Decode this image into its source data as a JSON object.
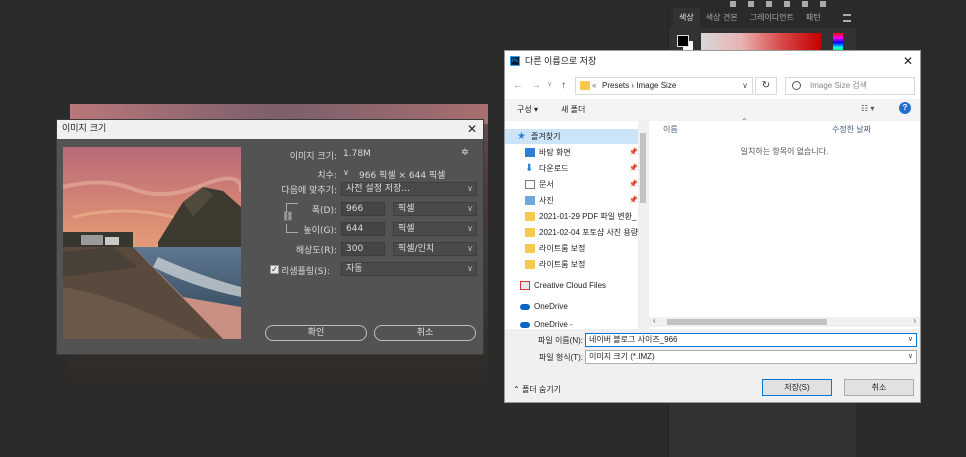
{
  "ps_panel": {
    "tabs": [
      "색상",
      "색상 견본",
      "그레이디언트",
      "패턴"
    ],
    "active_tab": "색상"
  },
  "image_size_dialog": {
    "title": "이미지 크기",
    "image_size_label": "이미지 크기:",
    "image_size_value": "1.78M",
    "dimensions_label": "치수:",
    "dimensions_value": "966 픽셀 × 644 픽셀",
    "fit_to_label": "다음에 맞추기:",
    "fit_to_value": "사전 설정 저장...",
    "width_label": "폭(D):",
    "width_value": "966",
    "width_unit": "픽셀",
    "height_label": "높이(G):",
    "height_value": "644",
    "height_unit": "픽셀",
    "resolution_label": "해상도(R):",
    "resolution_value": "300",
    "resolution_unit": "픽셀/인치",
    "resample_label": "리샘플링(S):",
    "resample_value": "자동",
    "resample_checked": true,
    "ok_label": "확인",
    "cancel_label": "취소"
  },
  "save_dialog": {
    "title": "다른 이름으로 저장",
    "app_icon": "Ps",
    "path_chevron": "«",
    "path": [
      "Presets",
      "Image Size"
    ],
    "search_placeholder": "Image Size 검색",
    "organize_label": "구성 ▾",
    "new_folder_label": "새 폴더",
    "nav_items": [
      {
        "label": "즐겨찾기",
        "icon": "star-icon"
      },
      {
        "label": "바탕 화면",
        "icon": "desktop-icon"
      },
      {
        "label": "다운로드",
        "icon": "download-icon"
      },
      {
        "label": "문서",
        "icon": "document-icon"
      },
      {
        "label": "사진",
        "icon": "pictures-icon"
      },
      {
        "label": "2021-01-29 PDF 파일 변환_",
        "icon": "folder-icon"
      },
      {
        "label": "2021-02-04 포토샵 사진 용량",
        "icon": "folder-icon"
      },
      {
        "label": "라이트룸 보정",
        "icon": "folder-icon"
      },
      {
        "label": "라이트룸 보정",
        "icon": "folder-icon"
      },
      {
        "label": "Creative Cloud Files",
        "icon": "creative-cloud-icon"
      },
      {
        "label": "OneDrive",
        "icon": "onedrive-icon"
      },
      {
        "label": "OneDrive -",
        "icon": "onedrive-icon"
      }
    ],
    "column_name": "이름",
    "column_modified": "수정한 날짜",
    "empty_message": "일치하는 항목이 없습니다.",
    "filename_label": "파일 이름(N):",
    "filename_value": "네이버 블로그 사이즈_966",
    "filetype_label": "파일 형식(T):",
    "filetype_value": "이미지 크기 (*.IMZ)",
    "hide_folders_label": "폴더 숨기기",
    "save_label": "저장(S)",
    "cancel_label": "취소"
  },
  "colors": {
    "ps_bg": "#2b2b2b",
    "dialog_gray": "#535353",
    "accent_blue": "#0078d7",
    "folder_yellow": "#f5c94a"
  }
}
